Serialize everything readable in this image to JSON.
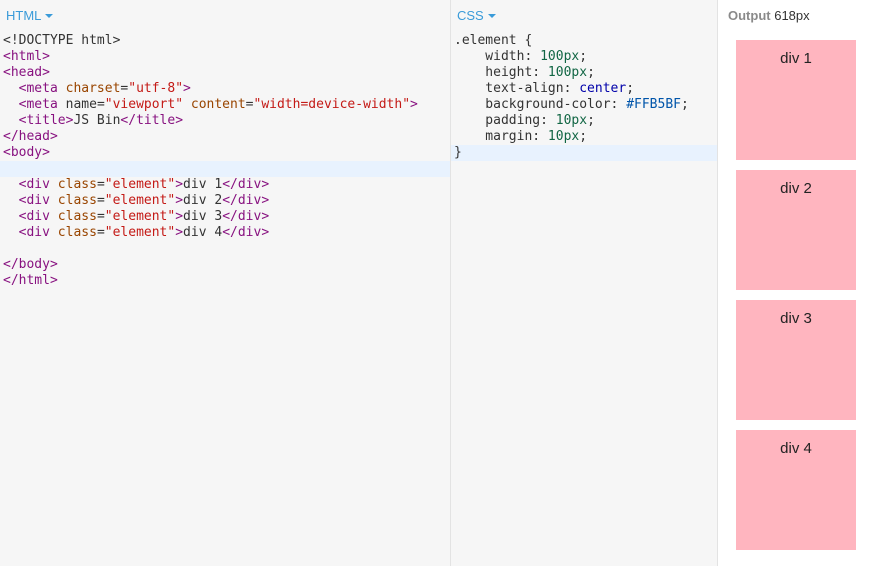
{
  "html_panel": {
    "label": "HTML",
    "lines": [
      [
        {
          "t": "<!DOCTYPE html>",
          "c": ""
        }
      ],
      [
        {
          "t": "<html>",
          "c": "tag"
        }
      ],
      [
        {
          "t": "<head>",
          "c": "tag"
        }
      ],
      [
        {
          "t": "  ",
          "c": ""
        },
        {
          "t": "<meta ",
          "c": "tag"
        },
        {
          "t": "charset",
          "c": "attr"
        },
        {
          "t": "=",
          "c": ""
        },
        {
          "t": "\"utf-8\"",
          "c": "str-red"
        },
        {
          "t": ">",
          "c": "tag"
        }
      ],
      [
        {
          "t": "  ",
          "c": ""
        },
        {
          "t": "<meta ",
          "c": "tag"
        },
        {
          "t": "name",
          "c": ""
        },
        {
          "t": "=",
          "c": ""
        },
        {
          "t": "\"viewport\"",
          "c": "str-red"
        },
        {
          "t": " content",
          "c": "attr"
        },
        {
          "t": "=",
          "c": ""
        },
        {
          "t": "\"width=device-width\"",
          "c": "str-red"
        },
        {
          "t": ">",
          "c": "tag"
        }
      ],
      [
        {
          "t": "  ",
          "c": ""
        },
        {
          "t": "<title>",
          "c": "tag"
        },
        {
          "t": "JS Bin",
          "c": ""
        },
        {
          "t": "</title>",
          "c": "tag"
        }
      ],
      [
        {
          "t": "</head>",
          "c": "tag"
        }
      ],
      [
        {
          "t": "<body>",
          "c": "tag"
        }
      ],
      [],
      [
        {
          "t": "  ",
          "c": ""
        },
        {
          "t": "<div ",
          "c": "tag"
        },
        {
          "t": "class",
          "c": "attr"
        },
        {
          "t": "=",
          "c": ""
        },
        {
          "t": "\"element\"",
          "c": "str-red"
        },
        {
          "t": ">",
          "c": "tag"
        },
        {
          "t": "div 1",
          "c": ""
        },
        {
          "t": "</div>",
          "c": "tag"
        }
      ],
      [
        {
          "t": "  ",
          "c": ""
        },
        {
          "t": "<div ",
          "c": "tag"
        },
        {
          "t": "class",
          "c": "attr"
        },
        {
          "t": "=",
          "c": ""
        },
        {
          "t": "\"element\"",
          "c": "str-red"
        },
        {
          "t": ">",
          "c": "tag"
        },
        {
          "t": "div 2",
          "c": ""
        },
        {
          "t": "</div>",
          "c": "tag"
        }
      ],
      [
        {
          "t": "  ",
          "c": ""
        },
        {
          "t": "<div ",
          "c": "tag"
        },
        {
          "t": "class",
          "c": "attr"
        },
        {
          "t": "=",
          "c": ""
        },
        {
          "t": "\"element\"",
          "c": "str-red"
        },
        {
          "t": ">",
          "c": "tag"
        },
        {
          "t": "div 3",
          "c": ""
        },
        {
          "t": "</div>",
          "c": "tag"
        }
      ],
      [
        {
          "t": "  ",
          "c": ""
        },
        {
          "t": "<div ",
          "c": "tag"
        },
        {
          "t": "class",
          "c": "attr"
        },
        {
          "t": "=",
          "c": ""
        },
        {
          "t": "\"element\"",
          "c": "str-red"
        },
        {
          "t": ">",
          "c": "tag"
        },
        {
          "t": "div 4",
          "c": ""
        },
        {
          "t": "</div>",
          "c": "tag"
        }
      ],
      [],
      [
        {
          "t": "</body>",
          "c": "tag"
        }
      ],
      [
        {
          "t": "</html>",
          "c": "tag"
        }
      ]
    ],
    "active_line": 8
  },
  "css_panel": {
    "label": "CSS",
    "lines": [
      [
        {
          "t": ".element {",
          "c": ""
        }
      ],
      [
        {
          "t": "    width: ",
          "c": ""
        },
        {
          "t": "100px",
          "c": "num"
        },
        {
          "t": ";",
          "c": ""
        }
      ],
      [
        {
          "t": "    height: ",
          "c": ""
        },
        {
          "t": "100px",
          "c": "num"
        },
        {
          "t": ";",
          "c": ""
        }
      ],
      [
        {
          "t": "    text-align: ",
          "c": ""
        },
        {
          "t": "center",
          "c": "kw"
        },
        {
          "t": ";",
          "c": ""
        }
      ],
      [
        {
          "t": "    background-color: ",
          "c": ""
        },
        {
          "t": "#FFB5BF",
          "c": "hex"
        },
        {
          "t": ";",
          "c": ""
        }
      ],
      [
        {
          "t": "    padding: ",
          "c": ""
        },
        {
          "t": "10px",
          "c": "num"
        },
        {
          "t": ";",
          "c": ""
        }
      ],
      [
        {
          "t": "    margin: ",
          "c": ""
        },
        {
          "t": "10px",
          "c": "num"
        },
        {
          "t": ";",
          "c": ""
        }
      ],
      [
        {
          "t": "}",
          "c": ""
        }
      ]
    ],
    "active_line": 7
  },
  "output_panel": {
    "label": "Output",
    "width_readout": "618px",
    "box_color": "#FFB5BF",
    "boxes": [
      "div 1",
      "div 2",
      "div 3",
      "div 4"
    ]
  },
  "colors": {
    "accent": "#3a9bd9",
    "editor_bg": "#f6f6f6",
    "active_line": "#e8f2fe"
  }
}
